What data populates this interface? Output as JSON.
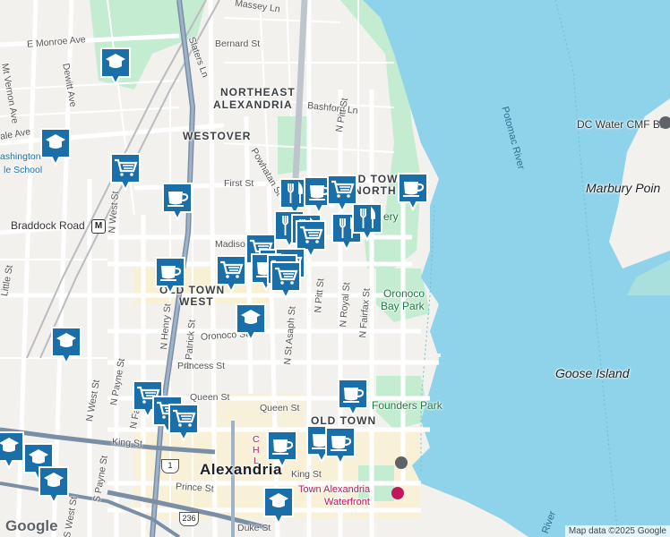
{
  "labels": {
    "massey": "Massey Ln",
    "monroe": "E Monroe Ave",
    "bernard": "Bernard St",
    "slaters": "Slaters Ln",
    "mt_vernon": "Mt Vernon Ave",
    "dewitt": "Dewitt Ave",
    "washington_school": "ashington",
    "washington_school2": "le School",
    "glebe": "ale Ave",
    "northeast": "NORTHEAST",
    "alexandria_ne": "ALEXANDRIA",
    "bashford": "Bashford Ln",
    "westover": "WESTOVER",
    "powhatan": "Powhatan St",
    "n_pitt_top": "N Pitt St",
    "first": "First St",
    "old_town_north1": "OLD TOWN",
    "old_town_north2": "NORTH",
    "braddock": "Braddock Road",
    "n_west": "N West St",
    "madison": "Madison",
    "old_town_west1": "OLD TOWN",
    "old_town_west2": "WEST",
    "n_henry": "N Henry St",
    "n_patrick": "N Patrick St",
    "oronoco": "Oronoco St",
    "princess": "Princess St",
    "queen_w": "Queen St",
    "queen_e": "Queen St",
    "n_asaph": "N St Asaph St",
    "n_pitt": "N Pitt St",
    "n_royal": "N Royal St",
    "n_fairfax": "N Fairfax St",
    "oronoco_park1": "Oronoco",
    "oronoco_park2": "Bay Park",
    "founders": "Founders Park",
    "old_town": "OLD TOWN",
    "king_w": "King St",
    "king_e": "King St",
    "alexandria": "Alexandria",
    "prince": "Prince St",
    "duke": "Duke St",
    "waterfront1": "Town Alexandria",
    "waterfront2": "Waterfront",
    "potomac_top": "Potomac River",
    "potomac_bottom": "River",
    "dc_water": "DC Water CMF Bld",
    "marbury": "Marbury Poin",
    "goose": "Goose Island",
    "cemetery": "ery",
    "s_payne": "S Payne St",
    "s_west": "S West St",
    "n_payne": "N Payne St",
    "n_fayette": "N Fayette",
    "n_west2": "N West St",
    "little": "Little St",
    "route_1": "1",
    "route_236": "236",
    "metro": "M",
    "christ_church1": "C",
    "christ_church2": "H",
    "christ_church3": "L",
    "logo": "Google",
    "attribution": "Map data ©2025 Google"
  },
  "markers": [
    {
      "type": "school",
      "icon": "school-icon"
    },
    {
      "type": "school",
      "icon": "school-icon"
    },
    {
      "type": "grocery",
      "icon": "cart-icon"
    },
    {
      "type": "cafe",
      "icon": "coffee-cup-icon"
    },
    {
      "type": "restaurant",
      "icon": "fork-knife-icon"
    },
    {
      "type": "cafe",
      "icon": "coffee-cup-icon"
    },
    {
      "type": "grocery",
      "icon": "cart-icon"
    },
    {
      "type": "cafe",
      "icon": "coffee-cup-icon"
    },
    {
      "type": "restaurant",
      "icon": "fork-knife-icon"
    },
    {
      "type": "restaurant",
      "icon": "fork-knife-icon"
    },
    {
      "type": "grocery",
      "icon": "cart-icon"
    },
    {
      "type": "restaurant",
      "icon": "fork-knife-icon"
    },
    {
      "type": "restaurant",
      "icon": "fork-knife-icon"
    },
    {
      "type": "grocery",
      "icon": "cart-icon"
    },
    {
      "type": "grocery",
      "icon": "cart-icon"
    },
    {
      "type": "cafe",
      "icon": "coffee-cup-icon"
    },
    {
      "type": "cafe",
      "icon": "coffee-cup-icon"
    },
    {
      "type": "grocery",
      "icon": "cart-icon"
    },
    {
      "type": "cafe",
      "icon": "coffee-cup-icon"
    },
    {
      "type": "grocery",
      "icon": "cart-icon"
    },
    {
      "type": "grocery",
      "icon": "cart-icon"
    },
    {
      "type": "school",
      "icon": "school-icon"
    },
    {
      "type": "school",
      "icon": "school-icon"
    },
    {
      "type": "cafe",
      "icon": "coffee-cup-icon"
    },
    {
      "type": "grocery",
      "icon": "cart-icon"
    },
    {
      "type": "grocery",
      "icon": "cart-icon"
    },
    {
      "type": "cafe",
      "icon": "coffee-cup-icon"
    },
    {
      "type": "grocery",
      "icon": "cart-icon"
    },
    {
      "type": "cafe",
      "icon": "coffee-cup-icon"
    },
    {
      "type": "cafe",
      "icon": "coffee-cup-icon"
    },
    {
      "type": "school",
      "icon": "school-icon"
    },
    {
      "type": "school",
      "icon": "school-icon"
    },
    {
      "type": "school",
      "icon": "school-icon"
    },
    {
      "type": "school",
      "icon": "school-icon"
    }
  ],
  "colors": {
    "water": "#8fd3ea",
    "park": "#c3ecd0",
    "land": "#f2f1ee",
    "commercial": "#fbf0c8",
    "marker_fill": "#1a6fa8",
    "marker_border": "#ffffff"
  }
}
